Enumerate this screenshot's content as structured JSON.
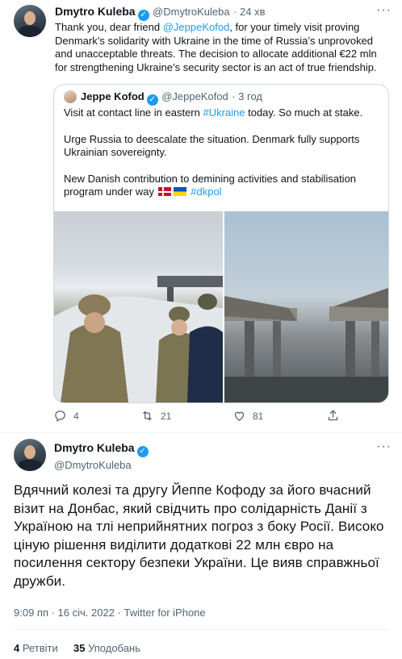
{
  "tweet1": {
    "author_name": "Dmytro Kuleba",
    "author_handle": "@DmytroKuleba",
    "time": "· 24 хв",
    "text_1": "Thank you, dear friend ",
    "mention": "@JeppeKofod",
    "text_2": ", for your timely visit proving Denmark’s solidarity with Ukraine in the time of Russia’s unprovoked and unacceptable threats. The decision to allocate additional €22 mln for strengthening Ukraine’s security sector is an act of true friendship."
  },
  "quote": {
    "author_name": "Jeppe Kofod",
    "author_handle": "@JeppeKofod",
    "time": "· 3 год",
    "line1_a": "Visit at contact line in eastern ",
    "line1_hashtag": "#Ukraine",
    "line1_b": " today. So much at stake.",
    "para2": "Urge Russia to deescalate the situation. Denmark fully supports Ukrainian sovereignty.",
    "para3_a": "New Danish contribution to demining activities and stabilisation program under way ",
    "para3_hashtag": "#dkpol",
    "photo_left": "photo-soldiers-at-contact-line",
    "photo_right": "photo-destroyed-bridge"
  },
  "actions": {
    "reply_count": "4",
    "retweet_count": "21",
    "like_count": "81"
  },
  "tweet2": {
    "author_name": "Dmytro Kuleba",
    "author_handle": "@DmytroKuleba",
    "text": "Вдячний колезі та другу Йеппе Кофоду за його вчасний візит на Донбас, який свідчить про солідарність Данії з Україною на тлі неприйнятних погроз з боку Росії. Високо ціную рішення виділити додаткові 22 млн євро на посилення сектору безпеки України. Це вияв справжньої дружби.",
    "timestamp": "9:09 пп · 16 січ. 2022 · ",
    "source": "Twitter for iPhone",
    "retweets_count": "4",
    "retweets_label": "Ретвіти",
    "likes_count": "35",
    "likes_label": "Уподобань"
  },
  "colors": {
    "accent": "#1d9bf0",
    "text": "#0f1419",
    "secondary": "#536471",
    "border": "#cfd9de"
  }
}
